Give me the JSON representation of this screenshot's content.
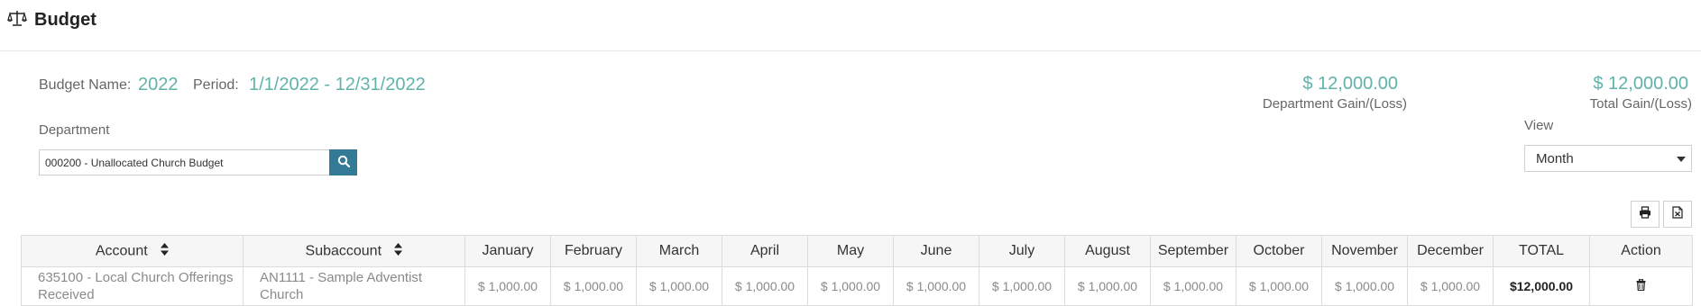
{
  "page": {
    "title": "Budget",
    "icon": "balance-scale-icon"
  },
  "budget": {
    "name_label": "Budget Name:",
    "name_value": "2022",
    "period_label": "Period:",
    "period_value": "1/1/2022 - 12/31/2022"
  },
  "summary": {
    "department_gain_value": "$ 12,000.00",
    "department_gain_label": "Department Gain/(Loss)",
    "total_gain_value": "$ 12,000.00",
    "total_gain_label": "Total Gain/(Loss)"
  },
  "department": {
    "label": "Department",
    "value": "000200 - Unallocated Church Budget"
  },
  "view": {
    "label": "View",
    "selected": "Month"
  },
  "toolbar": {
    "print_icon": "print-icon",
    "excel_icon": "excel-export-icon"
  },
  "colors": {
    "accent": "#5fb3a9",
    "button": "#337a96"
  },
  "table": {
    "headers": [
      "Account",
      "Subaccount",
      "January",
      "February",
      "March",
      "April",
      "May",
      "June",
      "July",
      "August",
      "September",
      "October",
      "November",
      "December",
      "TOTAL",
      "Action"
    ],
    "rows": [
      {
        "account": "635100 - Local Church Offerings Received",
        "subaccount": "AN1111 - Sample Adventist Church",
        "months": [
          "$ 1,000.00",
          "$ 1,000.00",
          "$ 1,000.00",
          "$ 1,000.00",
          "$ 1,000.00",
          "$ 1,000.00",
          "$ 1,000.00",
          "$ 1,000.00",
          "$ 1,000.00",
          "$ 1,000.00",
          "$ 1,000.00",
          "$ 1,000.00"
        ],
        "total": "$12,000.00",
        "action_icon": "trash-icon"
      }
    ]
  }
}
